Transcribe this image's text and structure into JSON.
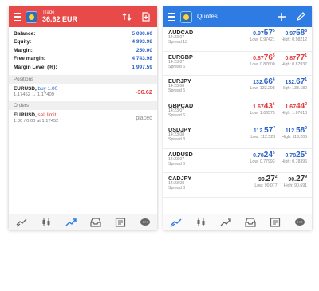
{
  "trade": {
    "title_small": "Trade",
    "title_main": "36.62 EUR",
    "summary": [
      {
        "label": "Balance:",
        "value": "5 030.60"
      },
      {
        "label": "Equity:",
        "value": "4 993.98"
      },
      {
        "label": "Margin:",
        "value": "250.00"
      },
      {
        "label": "Free margin:",
        "value": "4 743.98"
      },
      {
        "label": "Margin Level (%):",
        "value": "1 997.59"
      }
    ],
    "positions_header": "Positions",
    "position": {
      "symbol": "EURUSD,",
      "action": "buy 1.00",
      "prices": "1.17452 → 1.17409",
      "profit": "-36.62"
    },
    "orders_header": "Orders",
    "order": {
      "symbol": "EURUSD,",
      "action": "sell limit",
      "prices": "1.00 / 0.00 at 1.17452",
      "status": "placed"
    }
  },
  "quotes": {
    "title": "Quotes",
    "rows": [
      {
        "sym": "AUDCAD",
        "time": "14:23:07",
        "spread": "Spread 13",
        "bid": {
          "pre": "0.97",
          "big": "57",
          "sup": "5",
          "color": "blue"
        },
        "ask": {
          "pre": "0.97",
          "big": "58",
          "sup": "8",
          "color": "blue"
        },
        "low": "Low: 0.97421",
        "high": "High: 0.98212"
      },
      {
        "sym": "EURGBP",
        "time": "14:23:07",
        "spread": "Spread 6",
        "bid": {
          "pre": "0.87",
          "big": "76",
          "sup": "5",
          "color": "red"
        },
        "ask": {
          "pre": "0.87",
          "big": "77",
          "sup": "1",
          "color": "red"
        },
        "low": "Low: 0.87600",
        "high": "High: 0.87937"
      },
      {
        "sym": "EURJPY",
        "time": "14:23:08",
        "spread": "Spread 6",
        "bid": {
          "pre": "132.",
          "big": "66",
          "sup": "6",
          "color": "blue"
        },
        "ask": {
          "pre": "132.",
          "big": "67",
          "sup": "1",
          "color": "blue"
        },
        "low": "Low: 132.298",
        "high": "High: 133.180"
      },
      {
        "sym": "GBPCAD",
        "time": "14:23:07",
        "spread": "Spread 6",
        "bid": {
          "pre": "1.67",
          "big": "43",
          "sup": "6",
          "color": "red"
        },
        "ask": {
          "pre": "1.67",
          "big": "44",
          "sup": "2",
          "color": "red"
        },
        "low": "Low: 1.66575",
        "high": "High: 1.67610"
      },
      {
        "sym": "USDJPY",
        "time": "14:23:08",
        "spread": "Spread 3",
        "bid": {
          "pre": "112.",
          "big": "57",
          "sup": "7",
          "color": "blue"
        },
        "ask": {
          "pre": "112.",
          "big": "58",
          "sup": "0",
          "color": "blue"
        },
        "low": "Low: 112.523",
        "high": "High: 113.205"
      },
      {
        "sym": "AUDUSD",
        "time": "14:23:07",
        "spread": "Spread 6",
        "bid": {
          "pre": "0.78",
          "big": "24",
          "sup": "5",
          "color": "blue"
        },
        "ask": {
          "pre": "0.78",
          "big": "25",
          "sup": "1",
          "color": "blue"
        },
        "low": "Low: 0.77993",
        "high": "High: 0.78396"
      },
      {
        "sym": "CADJPY",
        "time": "14:23:08",
        "spread": "Spread 8",
        "bid": {
          "pre": "90.",
          "big": "27",
          "sup": "2",
          "color": "dark"
        },
        "ask": {
          "pre": "90.",
          "big": "27",
          "sup": "9",
          "color": "dark"
        },
        "low": "Low: 90.077",
        "high": "High: 90.691"
      }
    ]
  },
  "icons": {
    "menu": "hamburger-icon",
    "sort": "sort-arrows-icon",
    "new_order": "new-order-icon",
    "add": "plus-icon",
    "edit": "pencil-icon",
    "nav": [
      "quotes-nav-icon",
      "chart-nav-icon",
      "trade-nav-icon",
      "history-nav-icon",
      "news-nav-icon",
      "chat-nav-icon"
    ]
  },
  "colors": {
    "trade_bar": "#e84a4a",
    "quotes_bar": "#2e7be3",
    "blue_price": "#2a62c9",
    "red_price": "#e23b3b"
  }
}
